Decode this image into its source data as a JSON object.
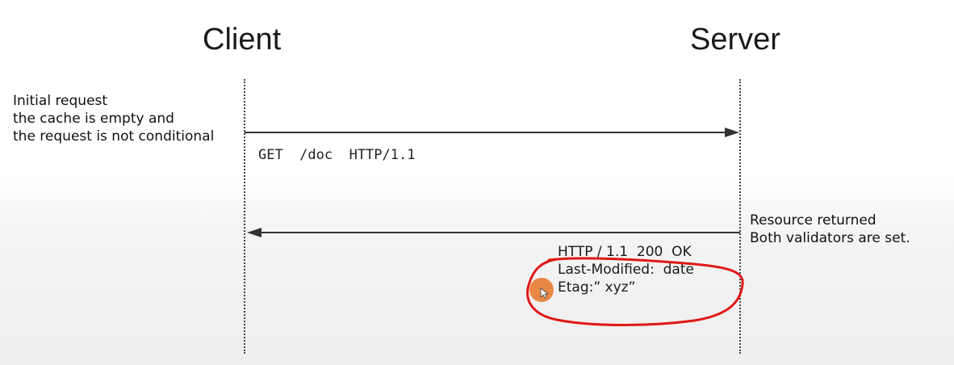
{
  "actors": {
    "client": "Client",
    "server": "Server"
  },
  "notes": {
    "initial": [
      "Initial request",
      "the cache is empty and",
      "the request is not conditional"
    ],
    "returned": [
      "Resource returned",
      "Both validators are set."
    ]
  },
  "messages": {
    "request": "GET  /doc  HTTP/1.1",
    "response": [
      "HTTP / 1.1  200  OK",
      "Last-Modified:  date",
      "Etag:” xyz”"
    ]
  },
  "colors": {
    "annotation_ring": "#e01818",
    "cursor": "#e8823a",
    "lines": "#333333"
  },
  "icons": {
    "cursor": "mouse-cursor-icon"
  }
}
